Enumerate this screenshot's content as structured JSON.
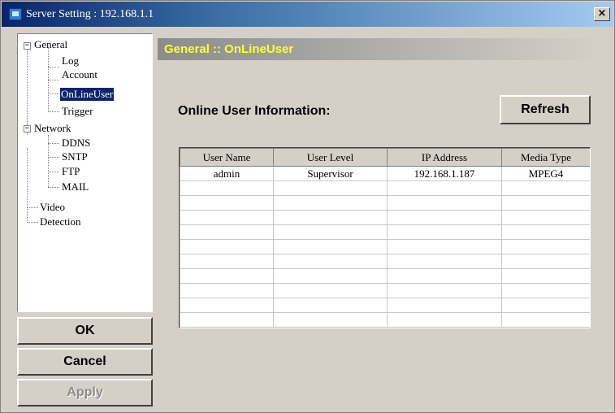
{
  "window": {
    "title": "Server Setting : 192.168.1.1",
    "close_glyph": "×"
  },
  "tree": {
    "general": "General",
    "log": "Log",
    "account": "Account",
    "onlineuser": "OnLineUser",
    "trigger": "Trigger",
    "network": "Network",
    "ddns": "DDNS",
    "sntp": "SNTP",
    "ftp": "FTP",
    "mail": "MAIL",
    "video": "Video",
    "detection": "Detection",
    "expanded_glyph": "−",
    "selected_item": "OnLineUser"
  },
  "buttons": {
    "ok": "OK",
    "cancel": "Cancel",
    "apply": "Apply",
    "refresh": "Refresh"
  },
  "main": {
    "header": "General :: OnLineUser",
    "section_label": "Online User Information:"
  },
  "table": {
    "columns": [
      "User Name",
      "User Level",
      "IP Address",
      "Media Type"
    ],
    "rows": [
      [
        "admin",
        "Supervisor",
        "192.168.1.187",
        "MPEG4"
      ],
      [
        "",
        "",
        "",
        ""
      ],
      [
        "",
        "",
        "",
        ""
      ],
      [
        "",
        "",
        "",
        ""
      ],
      [
        "",
        "",
        "",
        ""
      ],
      [
        "",
        "",
        "",
        ""
      ],
      [
        "",
        "",
        "",
        ""
      ],
      [
        "",
        "",
        "",
        ""
      ],
      [
        "",
        "",
        "",
        ""
      ],
      [
        "",
        "",
        "",
        ""
      ],
      [
        "",
        "",
        "",
        ""
      ]
    ]
  },
  "colors": {
    "titlebar_start": "#0a246a",
    "header_text": "#ffff33",
    "window_face": "#d4d0c8",
    "selection": "#0a246a"
  },
  "icons": {
    "app": "server-app-icon",
    "close": "close-icon",
    "expander": "tree-collapse-icon"
  }
}
